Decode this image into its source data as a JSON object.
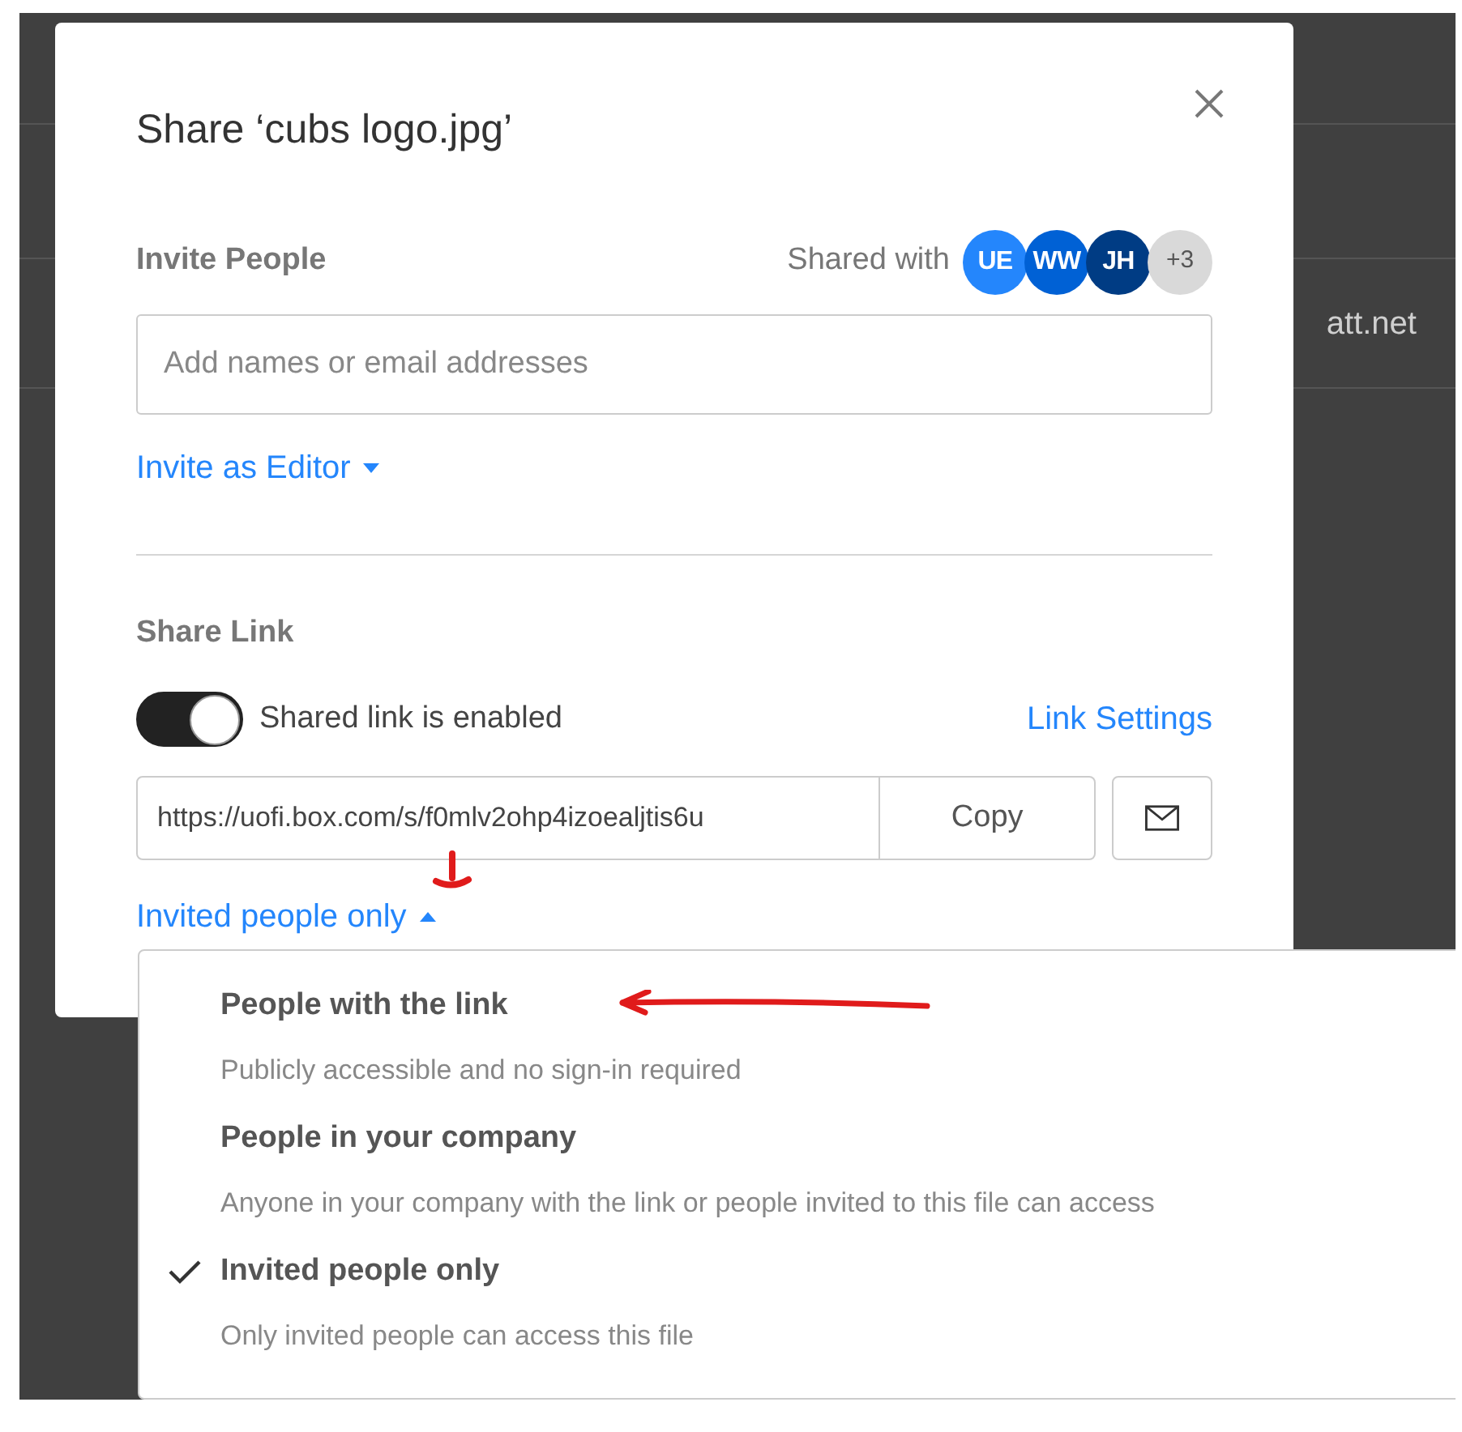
{
  "background": {
    "text": "att.net"
  },
  "dialog": {
    "title": "Share ‘cubs logo.jpg’",
    "invite": {
      "heading": "Invite People",
      "shared_with_label": "Shared with",
      "avatars": [
        {
          "initials": "UE",
          "color": "#2486fc"
        },
        {
          "initials": "WW",
          "color": "#0061d5"
        },
        {
          "initials": "JH",
          "color": "#003c84"
        }
      ],
      "more_count": "+3",
      "placeholder": "Add names or email addresses",
      "role_menu": "Invite as Editor"
    },
    "share_link": {
      "heading": "Share Link",
      "toggle": {
        "label": "Shared link is enabled",
        "on": true
      },
      "settings_link": "Link Settings",
      "url": "https://uofi.box.com/s/f0mlv2ohp4izoealjtis6u",
      "copy_button": "Copy",
      "access_menu": {
        "label": "Invited people only",
        "expanded": true
      }
    }
  },
  "access_options": [
    {
      "title": "People with the link",
      "description": "Publicly accessible and no sign-in required",
      "selected": false
    },
    {
      "title": "People in your company",
      "description": "Anyone in your company with the link or people invited to this file can access",
      "selected": false
    },
    {
      "title": "Invited people only",
      "description": "Only invited people can access this file",
      "selected": true
    }
  ]
}
